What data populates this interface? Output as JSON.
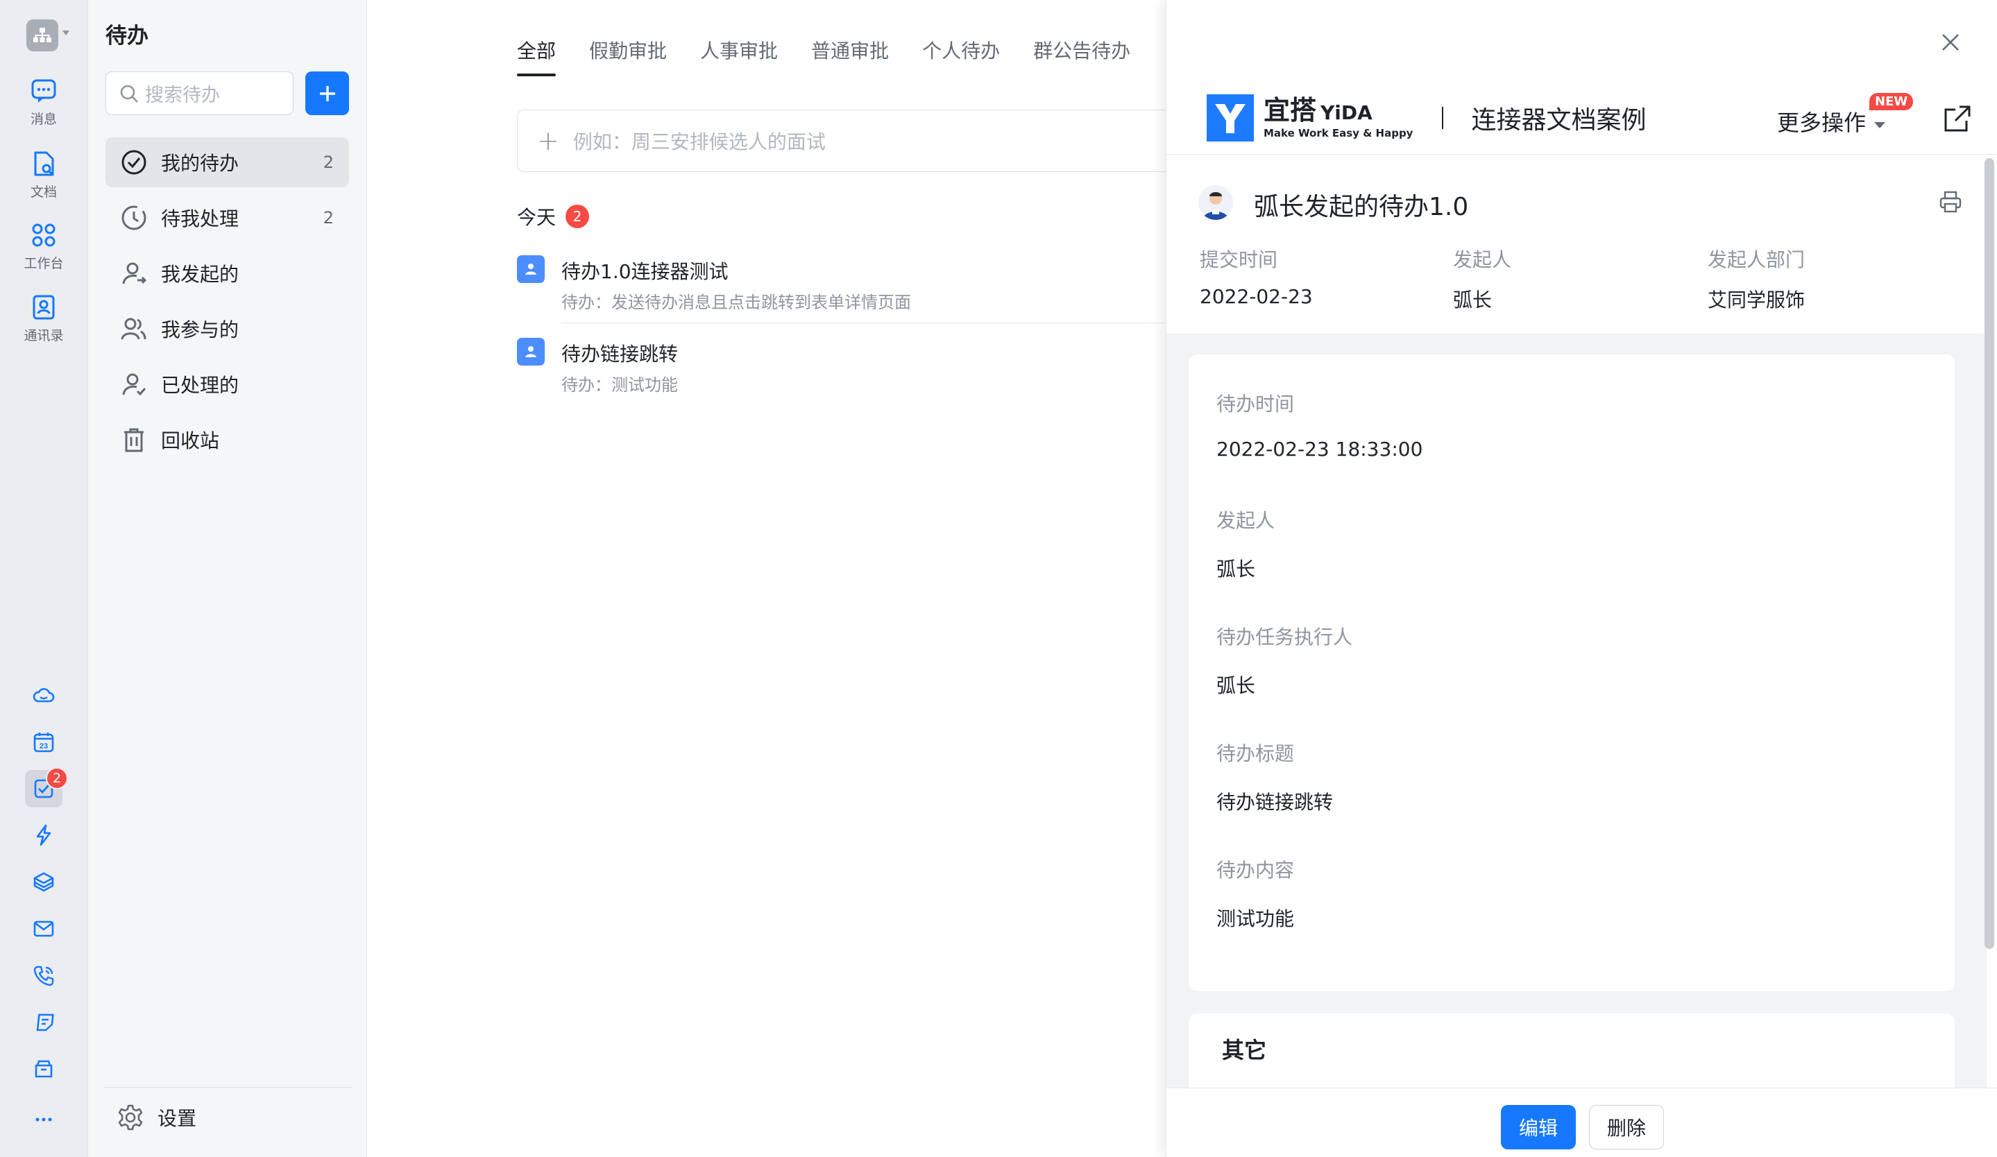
{
  "rail": {
    "nav": [
      {
        "label": "消息",
        "icon": "message-icon"
      },
      {
        "label": "文档",
        "icon": "doc-icon"
      },
      {
        "label": "工作台",
        "icon": "workbench-icon"
      },
      {
        "label": "通讯录",
        "icon": "contacts-icon"
      }
    ],
    "todo_badge": "2"
  },
  "sidebar": {
    "title": "待办",
    "search_placeholder": "搜索待办",
    "items": [
      {
        "label": "我的待办",
        "count": "2"
      },
      {
        "label": "待我处理",
        "count": "2"
      },
      {
        "label": "我发起的",
        "count": ""
      },
      {
        "label": "我参与的",
        "count": ""
      },
      {
        "label": "已处理的",
        "count": ""
      },
      {
        "label": "回收站",
        "count": ""
      }
    ],
    "settings_label": "设置"
  },
  "main": {
    "tabs": [
      "全部",
      "假勤审批",
      "人事审批",
      "普通审批",
      "个人待办",
      "群公告待办"
    ],
    "quick_add_placeholder": "例如：周三安排候选人的面试",
    "section_title": "今天",
    "section_count": "2",
    "todos": [
      {
        "title": "待办1.0连接器测试",
        "subtitle": "待办：发送待办消息且点击跳转到表单详情页面"
      },
      {
        "title": "待办链接跳转",
        "subtitle": "待办：测试功能"
      }
    ]
  },
  "panel": {
    "brand_name": "宜搭",
    "brand_en": "YiDA",
    "brand_slogan": "Make Work Easy & Happy",
    "app_name": "连接器文档案例",
    "more_ops": "更多操作",
    "new_tag": "NEW",
    "record_title": "弧长发起的待办1.0",
    "meta": [
      {
        "label": "提交时间",
        "value": "2022-02-23"
      },
      {
        "label": "发起人",
        "value": "弧长"
      },
      {
        "label": "发起人部门",
        "value": "艾同学服饰"
      }
    ],
    "fields": [
      {
        "label": "待办时间",
        "value": "2022-02-23 18:33:00"
      },
      {
        "label": "发起人",
        "value": "弧长"
      },
      {
        "label": "待办任务执行人",
        "value": "弧长"
      },
      {
        "label": "待办标题",
        "value": "待办链接跳转"
      },
      {
        "label": "待办内容",
        "value": "测试功能"
      }
    ],
    "other_title": "其它",
    "edit_label": "编辑",
    "delete_label": "删除"
  },
  "colors": {
    "primary": "#1678ff",
    "badge": "#f54a45",
    "rail_bg": "#ebedf0",
    "sidebar_bg": "#f5f6f7",
    "panel_gray": "#f2f3f5"
  }
}
